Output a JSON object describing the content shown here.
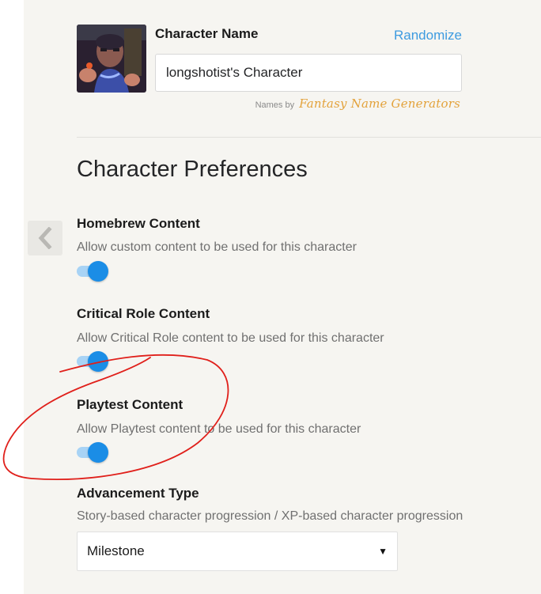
{
  "header": {
    "name_label": "Character Name",
    "randomize_label": "Randomize",
    "name_value": "longshotist's Character",
    "names_by_label": "Names by",
    "names_by_source": "Fantasy Name Generators"
  },
  "preferences": {
    "title": "Character Preferences",
    "items": [
      {
        "heading": "Homebrew Content",
        "description": "Allow custom content to be used for this character",
        "enabled": true
      },
      {
        "heading": "Critical Role Content",
        "description": "Allow Critical Role content to be used for this character",
        "enabled": true
      },
      {
        "heading": "Playtest Content",
        "description": "Allow Playtest content to be used for this character",
        "enabled": true
      }
    ],
    "advancement": {
      "heading": "Advancement Type",
      "description": "Story-based character progression / XP-based character progression",
      "selected": "Milestone"
    }
  },
  "icons": {
    "back": "chevron-left-icon",
    "select_arrow": "caret-down-icon"
  },
  "colors": {
    "accent": "#1b8de6",
    "link": "#3d9be0",
    "annotation": "#e0201b",
    "logo": "#e3a23b"
  }
}
